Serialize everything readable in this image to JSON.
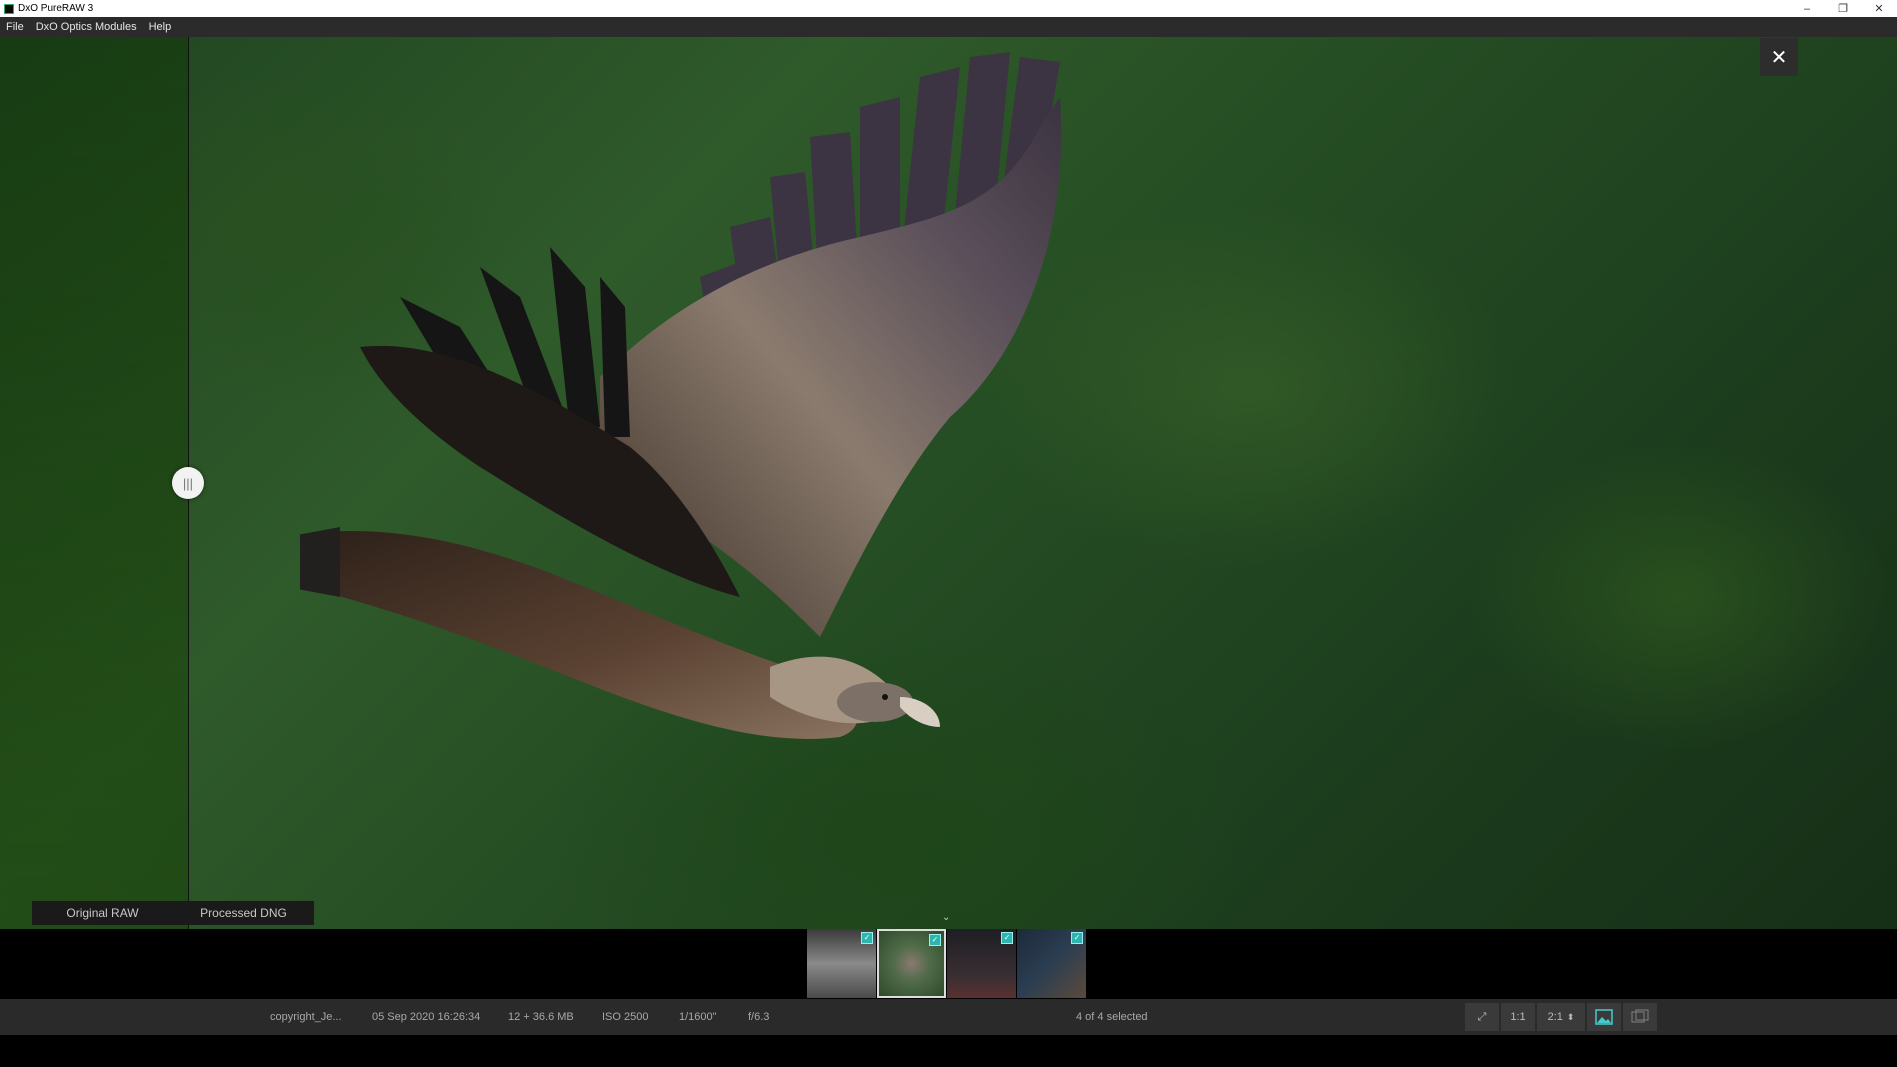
{
  "window": {
    "title": "DxO PureRAW 3",
    "minimize": "–",
    "restore": "❐",
    "close": "✕"
  },
  "menu": {
    "items": [
      "File",
      "DxO Optics Modules",
      "Help"
    ]
  },
  "viewer": {
    "close_label": "✕",
    "handle_glyph": "|||",
    "compare": {
      "left_label": "Original RAW",
      "right_label": "Processed DNG"
    },
    "collapse_glyph": "⌄"
  },
  "filmstrip": {
    "thumbnails": [
      {
        "name": "thumb-1",
        "selected": false,
        "checked": true,
        "color": "#6a6a6a"
      },
      {
        "name": "thumb-2",
        "selected": true,
        "checked": true,
        "color": "#4f6b48"
      },
      {
        "name": "thumb-3",
        "selected": false,
        "checked": true,
        "color": "#3a2f33"
      },
      {
        "name": "thumb-4",
        "selected": false,
        "checked": true,
        "color": "#2c3e52"
      }
    ],
    "check_glyph": "✓"
  },
  "status": {
    "filename": "copyright_Je...",
    "date": "05 Sep 2020 16:26:34",
    "size": "12 + 36.6 MB",
    "iso": "ISO 2500",
    "shutter": "1/1600\"",
    "aperture": "f/6.3",
    "selection": "4 of 4 selected",
    "tools": {
      "fit": "⤢",
      "one_to_one": "1:1",
      "zoom_value": "2:1",
      "zoom_arrows": "⬍",
      "single_view": "single-view-icon",
      "compare_view": "compare-view-icon"
    }
  },
  "colors": {
    "accent": "#2fb4b0",
    "bar": "#2a2a2a",
    "menubar": "#2b2b2b"
  }
}
